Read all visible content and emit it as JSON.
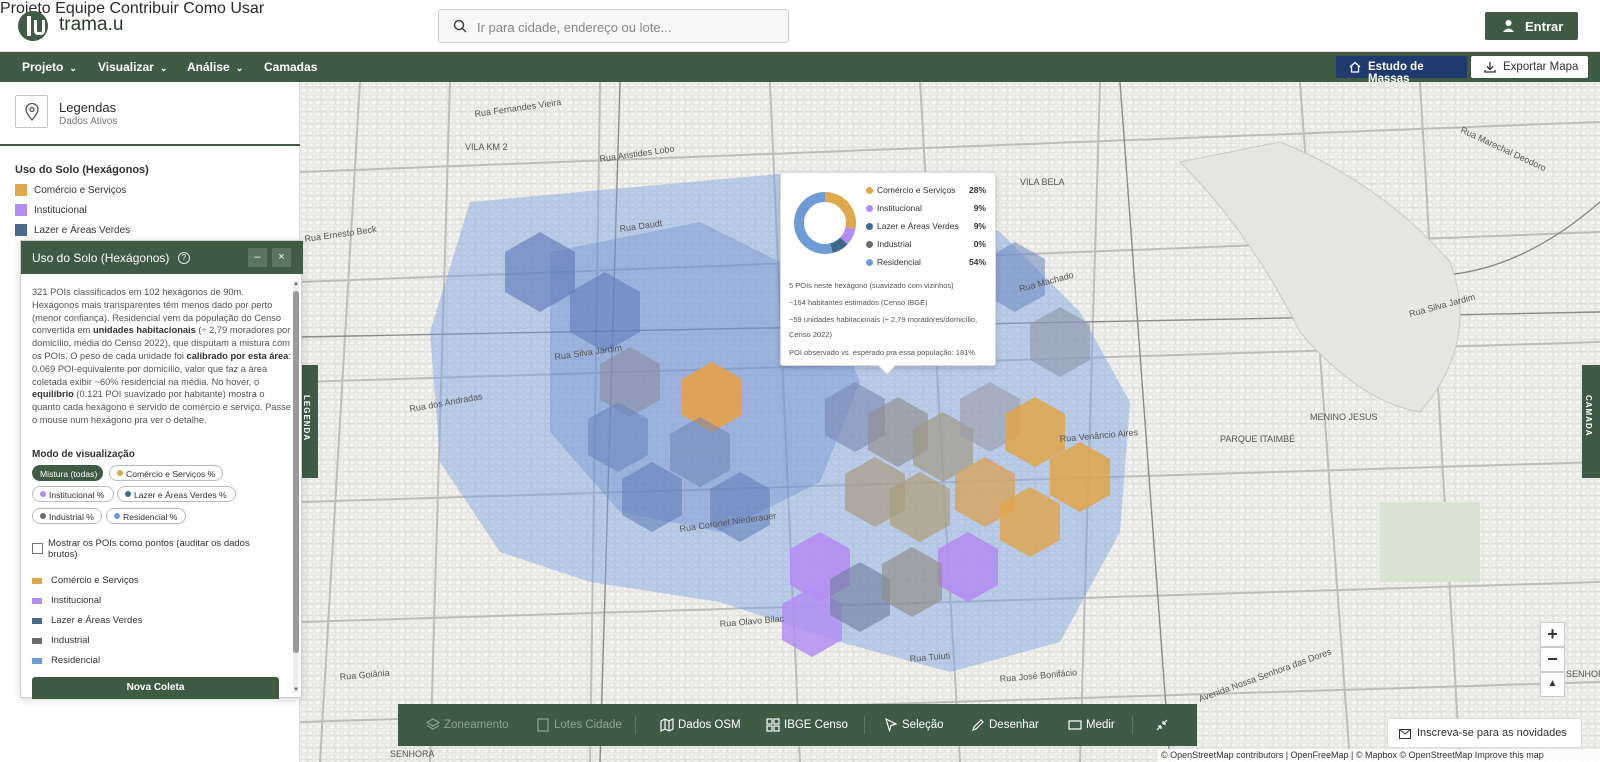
{
  "brand": "trama.u",
  "search": {
    "placeholder": "Ir para cidade, endereço ou lote..."
  },
  "topnav": [
    "Projeto",
    "Equipe",
    "Contribuir",
    "Como Usar"
  ],
  "login_label": "Entrar",
  "menubar": {
    "items": [
      "Projeto",
      "Visualizar",
      "Análise",
      "Camadas"
    ],
    "massas_label": "Estudo de Massas",
    "export_label": "Exportar Mapa"
  },
  "legend_panel": {
    "title": "Legendas",
    "subtitle": "Dados Ativos",
    "section": "Uso do Solo (Hexágonos)",
    "items": [
      {
        "label": "Comércio e Serviços",
        "color": "#e0a84a"
      },
      {
        "label": "Institucional",
        "color": "#b28cf0"
      },
      {
        "label": "Lazer e Áreas Verdes",
        "color": "#4a6c8a"
      }
    ]
  },
  "float_panel": {
    "title": "Uso do Solo (Hexágonos)",
    "help": "?",
    "minimize": "–",
    "close": "×",
    "desc": {
      "p1": "321 POIs classificados em 102 hexágonos de 90m. Hexágonos mais transparentes têm menos dado por perto (menor confiança). Residencial vem da população do Censo convertida em ",
      "b1": "unidades habitacionais",
      "p2": " (÷ 2,79 moradores por domicílio, média do Censo 2022), que disputam a mistura com os POIs. O peso de cada unidade foi ",
      "b2": "calibrado por esta área",
      "p3": ": 0.069 POI-equivalente por domicílio, valor que faz a área coletada exibir ~60% residencial na média. No hover, o ",
      "b3": "equilíbrio",
      "p4": " (0.121 POI suavizado por habitante) mostra o quanto cada hexágono é servido de comércio e serviço. Passe o mouse num hexágono pra ver o detalhe."
    },
    "mode_title": "Modo de visualização",
    "modes": [
      {
        "label": "Mistura (todas)",
        "active": true
      },
      {
        "label": "Comércio e Serviços %",
        "color": "#e0a84a"
      },
      {
        "label": "Institucional %",
        "color": "#b28cf0"
      },
      {
        "label": "Lazer e Áreas Verdes %",
        "color": "#3d6a8a"
      },
      {
        "label": "Industrial %",
        "color": "#6b6b6b"
      },
      {
        "label": "Residencial %",
        "color": "#6e9ad6"
      }
    ],
    "checkbox_label": "Mostrar os POIs como pontos (auditar os dados brutos)",
    "legend": [
      {
        "label": "Comércio e Serviços",
        "color": "#e0a84a"
      },
      {
        "label": "Institucional",
        "color": "#b28cf0"
      },
      {
        "label": "Lazer e Áreas Verdes",
        "color": "#4a6c8a"
      },
      {
        "label": "Industrial",
        "color": "#6b6b6b"
      },
      {
        "label": "Residencial",
        "color": "#6e9ad6"
      }
    ],
    "button": "Nova Coleta"
  },
  "popup": {
    "categories": [
      {
        "name": "Comércio e Serviços",
        "pct": "28%",
        "value": 28,
        "color": "#e0a84a"
      },
      {
        "name": "Institucional",
        "pct": "9%",
        "value": 9,
        "color": "#b28cf0"
      },
      {
        "name": "Lazer e Áreas Verdes",
        "pct": "9%",
        "value": 9,
        "color": "#3d6a8a"
      },
      {
        "name": "Industrial",
        "pct": "0%",
        "value": 0,
        "color": "#6b6b6b"
      },
      {
        "name": "Residencial",
        "pct": "54%",
        "value": 54,
        "color": "#6e9ad6"
      }
    ],
    "lines": [
      "5 POIs neste hexágono (suavizado com vizinhos)",
      "~164 habitantes estimados (Censo IBGE)",
      "~59 unidades habitacionais (÷ 2,79 moradores/domicílio, Censo 2022)",
      "POI observado vs. esperado pra essa população: 181%"
    ]
  },
  "map_labels": [
    "Rua Fernandes Vieira",
    "Rua Aristides Lobo",
    "Rua Daudt",
    "Rua Silva Jardim",
    "Rua dos Andradas",
    "Rua Coronel Niederauer",
    "Rua Olavo Bilac",
    "Rua Goiânia",
    "Rua Tuiuti",
    "Rua José Bonifácio",
    "Avenida Nossa Senhora das Dores",
    "Rua Venâncio Aires",
    "Rua Machado",
    "Rua Silva Jardim",
    "Rua Marechal Deodoro",
    "Rua Ernesto Beck",
    "VILA KM 2",
    "VILA BELA",
    "MENINO JESUS",
    "PARQUE ITAIMBÉ",
    "SENHORA",
    "SENHORA"
  ],
  "side_tabs": {
    "left": "LEGENDA",
    "right": "CAMADA"
  },
  "zoom": {
    "in": "+",
    "out": "−",
    "north": "▲"
  },
  "toolbar": [
    {
      "label": "Zoneamento",
      "disabled": true,
      "icon": "layers-icon"
    },
    {
      "label": "Lotes Cidade",
      "disabled": true,
      "icon": "document-icon"
    },
    {
      "label": "Dados OSM",
      "icon": "map-icon"
    },
    {
      "label": "IBGE Censo",
      "icon": "grid-icon"
    },
    {
      "label": "Seleção",
      "icon": "cursor-icon"
    },
    {
      "label": "Desenhar",
      "icon": "pencil-icon"
    },
    {
      "label": "Medir",
      "icon": "ruler-icon"
    },
    {
      "label": "",
      "icon": "collapse-icon"
    }
  ],
  "newsletter": "Inscreva-se para as novidades",
  "attribution": "© OpenStreetMap contributors | OpenFreeMap | © Mapbox © OpenStreetMap Improve this map"
}
